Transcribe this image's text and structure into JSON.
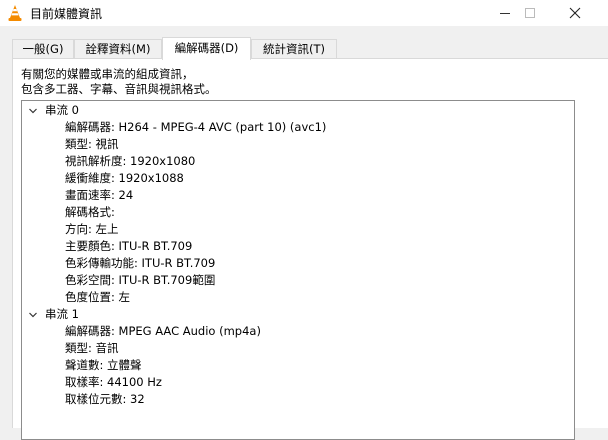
{
  "window": {
    "title": "目前媒體資訊",
    "icon": "vlc-cone-icon"
  },
  "tabs": [
    {
      "label": "一般(G)",
      "active": false
    },
    {
      "label": "詮釋資料(M)",
      "active": false
    },
    {
      "label": "編解碼器(D)",
      "active": true
    },
    {
      "label": "統計資訊(T)",
      "active": false
    }
  ],
  "description": {
    "line1": "有關您的媒體或串流的組成資訊，",
    "line2": "包含多工器、字幕、音訊與視訊格式。"
  },
  "streams": [
    {
      "label": "串流 0",
      "expanded": true,
      "items": [
        "編解碼器: H264 - MPEG-4 AVC (part 10) (avc1)",
        "類型: 視訊",
        "視訊解析度: 1920x1080",
        "緩衝維度: 1920x1088",
        "畫面速率: 24",
        "解碼格式: ",
        "方向: 左上",
        "主要顏色: ITU-R BT.709",
        "色彩傳輸功能: ITU-R BT.709",
        "色彩空間: ITU-R BT.709範圍",
        "色度位置: 左"
      ]
    },
    {
      "label": "串流 1",
      "expanded": true,
      "items": [
        "編解碼器: MPEG AAC Audio (mp4a)",
        "類型: 音訊",
        "聲道數: 立體聲",
        "取樣率: 44100 Hz",
        "取樣位元數: 32"
      ]
    }
  ],
  "colors": {
    "cone_orange": "#f48b00",
    "cone_stripe": "#ffffff"
  }
}
